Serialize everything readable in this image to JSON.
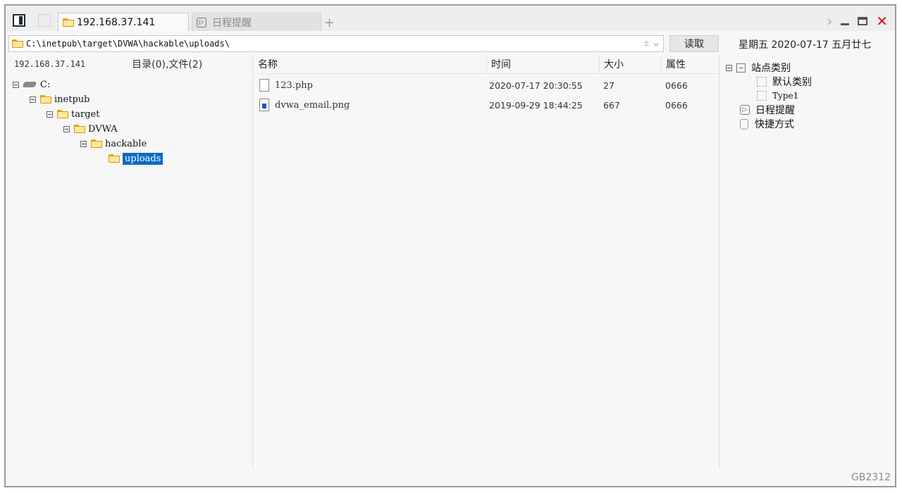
{
  "tabs": [
    {
      "label": "192.168.37.141",
      "active": true
    },
    {
      "label": "日程提醒",
      "active": false
    }
  ],
  "tab_add": "+",
  "window_controls": {
    "chevron": "›",
    "close": "✕"
  },
  "address": {
    "path": "C:\\inetpub\\target\\DVWA\\hackable\\uploads\\",
    "tools": "±"
  },
  "read_button": "读取",
  "datetime": "星期五 2020-07-17 五月廿七",
  "left_panel": {
    "ip": "192.168.37.141",
    "counts": "目录(0),文件(2)",
    "tree": [
      {
        "label": "C:",
        "icon": "drive-icon"
      },
      {
        "label": "inetpub",
        "icon": "folder-icon"
      },
      {
        "label": "target",
        "icon": "folder-icon"
      },
      {
        "label": "DVWA",
        "icon": "folder-icon"
      },
      {
        "label": "hackable",
        "icon": "folder-icon"
      },
      {
        "label": "uploads",
        "icon": "folder-icon",
        "selected": true
      }
    ]
  },
  "file_list": {
    "headers": {
      "name": "名称",
      "time": "时间",
      "size": "大小",
      "attr": "属性"
    },
    "rows": [
      {
        "name": "123.php",
        "time": "2020-07-17 20:30:55",
        "size": "27",
        "attr": "0666",
        "icon": "file-icon"
      },
      {
        "name": "dvwa_email.png",
        "time": "2019-09-29 18:44:25",
        "size": "667",
        "attr": "0666",
        "icon": "image-file-icon"
      }
    ]
  },
  "right_panel": {
    "site_category": "站点类别",
    "default_category": "默认类别",
    "type1": "Type1",
    "schedule": "日程提醒",
    "shortcuts": "快捷方式"
  },
  "status": {
    "encoding": "GB2312"
  }
}
